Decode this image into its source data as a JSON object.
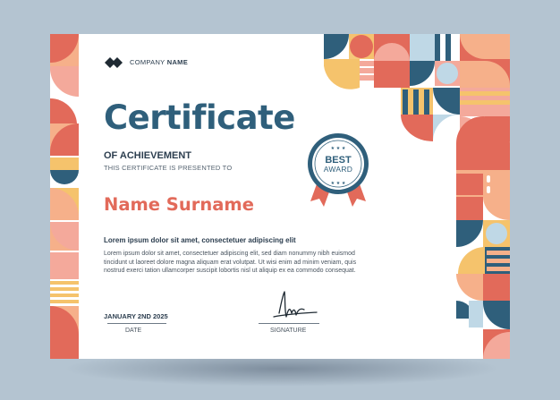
{
  "company": {
    "prefix": "COMPANY",
    "name": "NAME"
  },
  "certificate": {
    "title": "Certificate",
    "subtitle": "OF ACHIEVEMENT",
    "presented_to": "THIS CERTIFICATE IS PRESENTED TO",
    "recipient": "Name Surname",
    "lead": "Lorem ipsum dolor sit amet, consectetuer adipiscing elit",
    "body_lines": [
      "Lorem ipsum dolor sit amet, consectetuer adipiscing elit, sed diam nonummy nibh euismod",
      "tincidunt ut laoreet dolore magna aliquam erat volutpat. Ut wisi enim ad minim veniam, quis",
      "nostrud exerci tation ullamcorper suscipit lobortis nisl ut aliquip ex ea commodo consequat."
    ]
  },
  "badge": {
    "line1": "BEST",
    "line2": "AWARD"
  },
  "footer": {
    "date_value": "JANUARY 2ND 2025",
    "date_label": "DATE",
    "signature_label": "SIGNATURE"
  },
  "colors": {
    "navy": "#2f5f7b",
    "coral": "#e26a5a",
    "peach": "#f6b08a",
    "yellow": "#f5c36c",
    "light_blue": "#bfd8e6",
    "pink": "#f4a99b"
  },
  "icons": {
    "logo": "diamond-pair-logo-icon",
    "badge": "award-rosette-icon",
    "signature": "handwritten-signature-icon"
  }
}
